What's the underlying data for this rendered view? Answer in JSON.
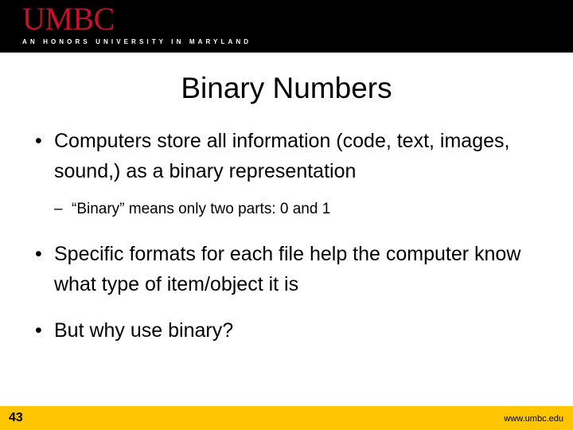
{
  "header": {
    "logo_wordmark": "UMBC",
    "logo_tagline": "AN HONORS UNIVERSITY IN MARYLAND",
    "background_color": "#000000",
    "wordmark_color": "#C8102E"
  },
  "slide": {
    "title": "Binary Numbers",
    "bullets": [
      {
        "level": 1,
        "marker": "•",
        "text": "Computers store all information (code, text, images, sound,) as a binary representation"
      },
      {
        "level": 2,
        "marker": "–",
        "text": "“Binary” means only two parts: 0 and 1"
      },
      {
        "level": 1,
        "marker": "•",
        "text": "Specific formats for each file help the computer know what type of item/object it is"
      },
      {
        "level": 1,
        "marker": "•",
        "text": "But why use binary?"
      }
    ]
  },
  "footer": {
    "page_number": "43",
    "url": "www.umbc.edu",
    "background_color": "#FFC600"
  }
}
